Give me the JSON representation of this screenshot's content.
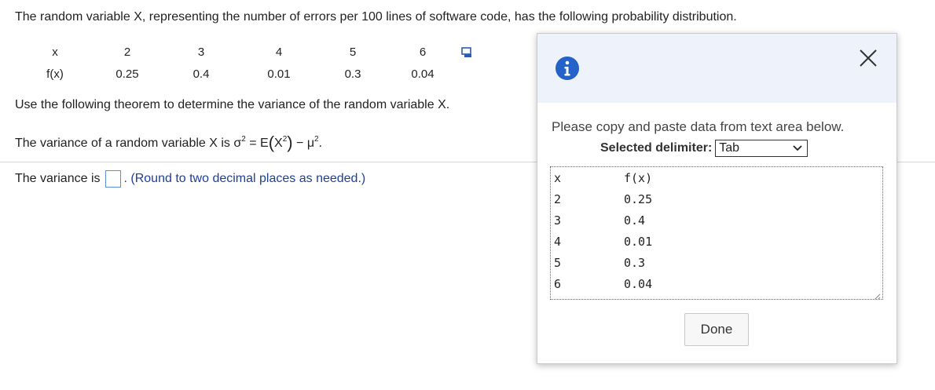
{
  "question": {
    "intro": "The random variable X, representing the number of errors per 100 lines of software code, has the following probability distribution.",
    "table": {
      "x_label": "x",
      "fx_label": "f(x)",
      "x_values": [
        "2",
        "3",
        "4",
        "5",
        "6"
      ],
      "fx_values": [
        "0.25",
        "0.4",
        "0.01",
        "0.3",
        "0.04"
      ]
    },
    "copy_icon": "copy-data-icon",
    "theorem_text": "Use the following theorem to determine the variance of the random variable X.",
    "variance_formula": {
      "prefix": "The variance of a random variable X is ",
      "sigma": "σ",
      "eq": " = E",
      "x": "X",
      "minus": " − ",
      "mu": "μ",
      "sup": "2",
      "period": "."
    },
    "answer": {
      "label": "The variance is",
      "value": "",
      "hint": ". (Round to two decimal places as needed.)"
    }
  },
  "modal": {
    "info_icon": "info-icon",
    "close_icon": "close-icon",
    "message": "Please copy and paste data from text area below.",
    "delimiter_label": "Selected delimiter:",
    "delimiter_value": "Tab",
    "rows": [
      {
        "x": "x",
        "fx": "f(x)"
      },
      {
        "x": "2",
        "fx": "0.25"
      },
      {
        "x": "3",
        "fx": "0.4"
      },
      {
        "x": "4",
        "fx": "0.01"
      },
      {
        "x": "5",
        "fx": "0.3"
      },
      {
        "x": "6",
        "fx": "0.04"
      }
    ],
    "done_label": "Done"
  },
  "colors": {
    "hint": "#1e3f96",
    "info_blue": "#2461c8",
    "modal_header": "#eef3fb"
  }
}
